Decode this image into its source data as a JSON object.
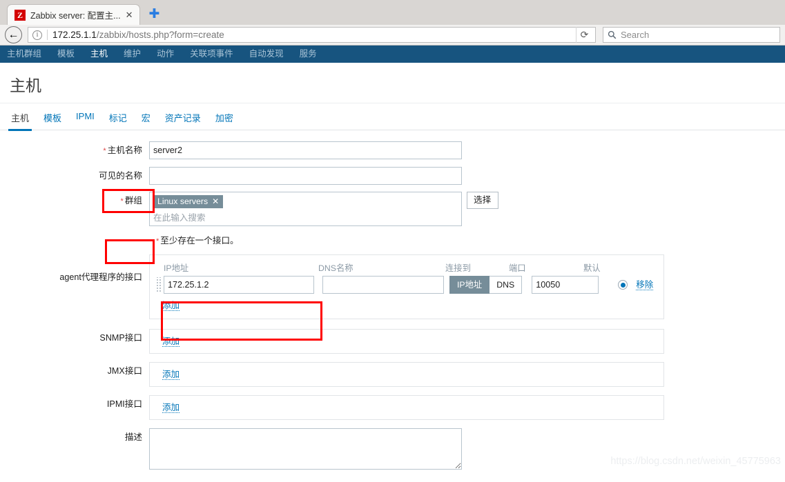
{
  "browser": {
    "tab": {
      "favicon_letter": "Z",
      "title": "Zabbix server: 配置主...",
      "close_label": "✕"
    },
    "new_tab_label": "✚",
    "back_icon": "←",
    "info_icon": "i",
    "url_host": "172.25.1.1",
    "url_path": "/zabbix/hosts.php?form=create",
    "reload_icon": "⟳",
    "search_placeholder": "Search",
    "search_icon": "🔍"
  },
  "topnav": {
    "items": [
      {
        "label": "主机群组",
        "active": false
      },
      {
        "label": "模板",
        "active": false
      },
      {
        "label": "主机",
        "active": true
      },
      {
        "label": "维护",
        "active": false
      },
      {
        "label": "动作",
        "active": false
      },
      {
        "label": "关联项事件",
        "active": false
      },
      {
        "label": "自动发现",
        "active": false
      },
      {
        "label": "服务",
        "active": false
      }
    ]
  },
  "page": {
    "title": "主机",
    "tabs": [
      {
        "label": "主机",
        "active": true
      },
      {
        "label": "模板",
        "active": false
      },
      {
        "label": "IPMI",
        "active": false
      },
      {
        "label": "标记",
        "active": false
      },
      {
        "label": "宏",
        "active": false
      },
      {
        "label": "资产记录",
        "active": false
      },
      {
        "label": "加密",
        "active": false
      }
    ]
  },
  "form": {
    "required_mark": "*",
    "host_name": {
      "label": "主机名称",
      "value": "server2",
      "required": true
    },
    "visible_name": {
      "label": "可见的名称",
      "value": "",
      "required": false
    },
    "groups": {
      "label": "群组",
      "required": true,
      "chip": "Linux servers",
      "chip_remove": "✕",
      "placeholder": "在此输入搜索",
      "select_button": "选择"
    },
    "interfaces_hint": "至少存在一个接口。",
    "agent_interface": {
      "label": "agent代理程序的接口",
      "columns": {
        "ip": "IP地址",
        "dns": "DNS名称",
        "connect_to": "连接到",
        "port": "端口",
        "default": "默认"
      },
      "ip_value": "172.25.1.2",
      "dns_value": "",
      "connect_ip_label": "IP地址",
      "connect_dns_label": "DNS",
      "connect_selected": "IP地址",
      "port_value": "10050",
      "default_selected": true,
      "remove_label": "移除",
      "add_label": "添加"
    },
    "snmp_interface": {
      "label": "SNMP接口",
      "add_label": "添加"
    },
    "jmx_interface": {
      "label": "JMX接口",
      "add_label": "添加"
    },
    "ipmi_interface": {
      "label": "IPMI接口",
      "add_label": "添加"
    },
    "description": {
      "label": "描述",
      "value": ""
    }
  },
  "watermark": "https://blog.csdn.net/weixin_45775963"
}
